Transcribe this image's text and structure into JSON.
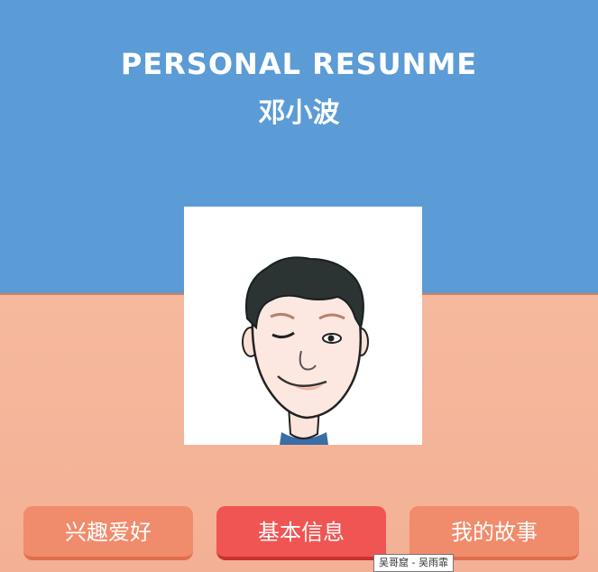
{
  "header": {
    "title": "PERSONAL RESUNME",
    "name": "邓小波"
  },
  "photo": {
    "icon": "cartoon-avatar-winking-man"
  },
  "nav": {
    "buttons": [
      {
        "label": "兴趣爱好",
        "active": false
      },
      {
        "label": "基本信息",
        "active": true
      },
      {
        "label": "我的故事",
        "active": false
      }
    ]
  },
  "tooltip": {
    "text": "吴哥窟 - 吴雨霏"
  },
  "colors": {
    "header_bg": "#5b9bd6",
    "body_bg": "#f3b396",
    "button_bg": "#f08b6c",
    "button_active_bg": "#f05553"
  }
}
